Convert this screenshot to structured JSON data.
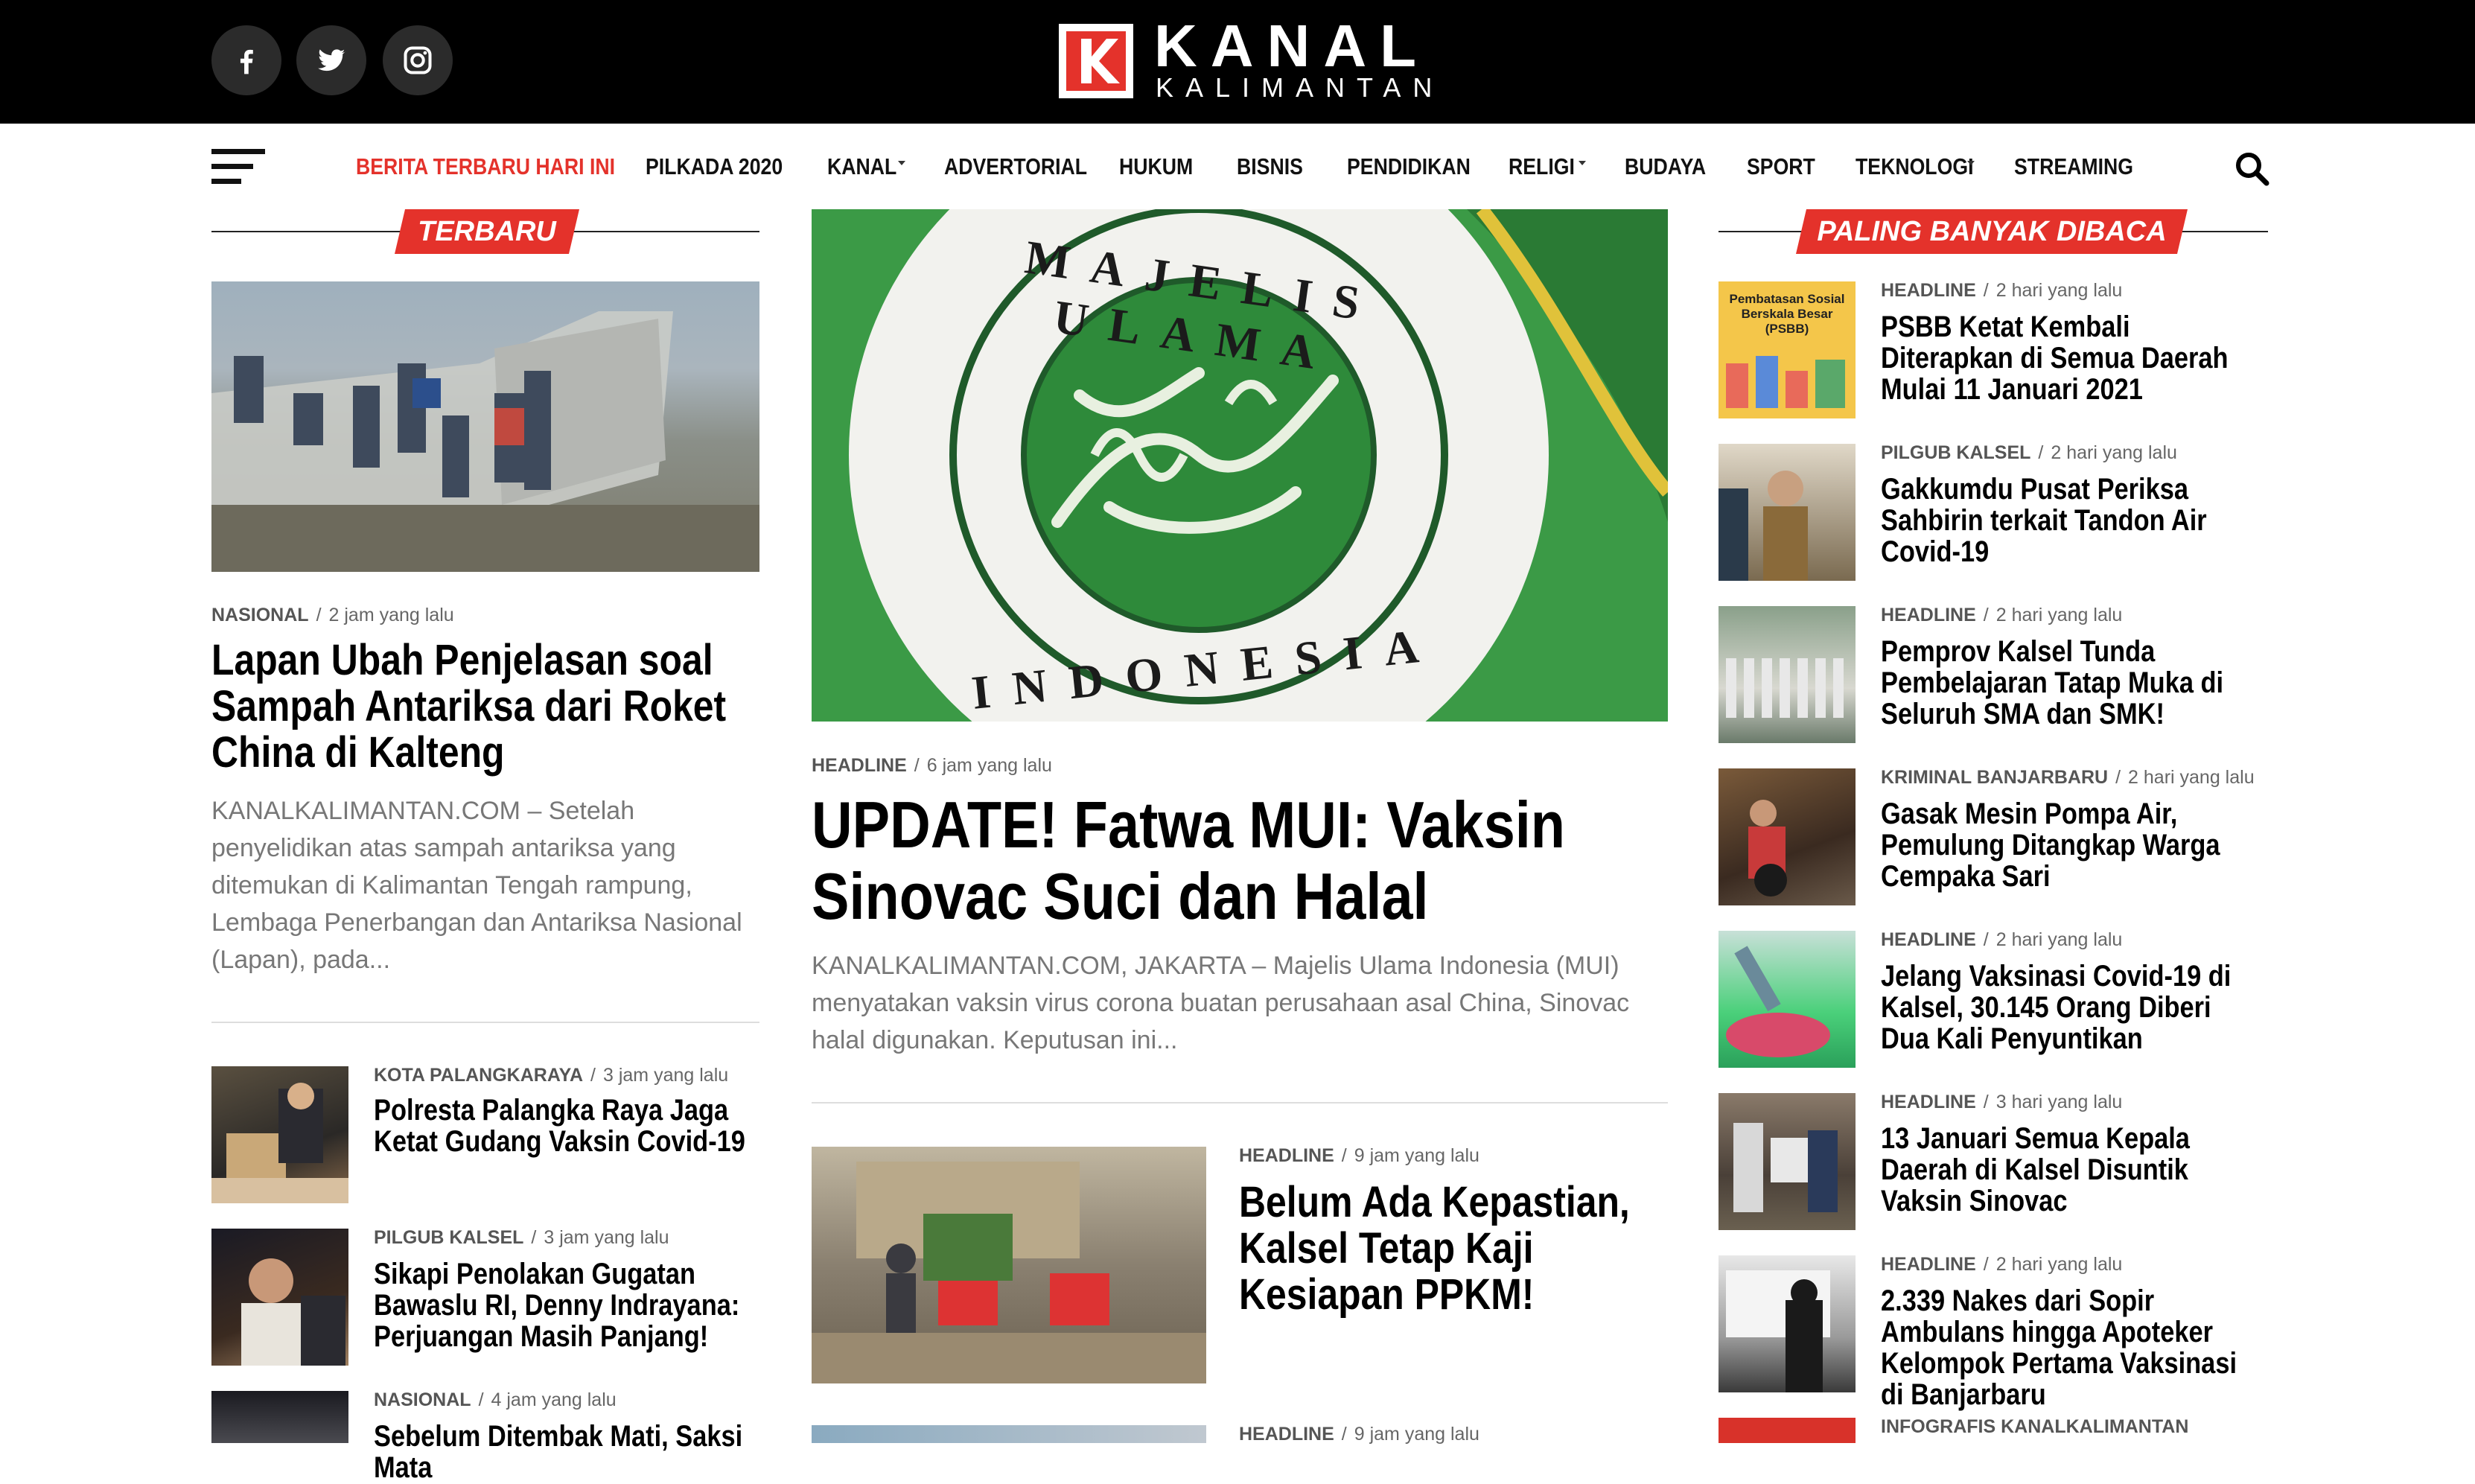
{
  "header": {
    "brand_title": "KANAL",
    "brand_subtitle": "KALIMANTAN",
    "social": [
      "facebook-icon",
      "twitter-icon",
      "instagram-icon"
    ]
  },
  "nav": {
    "items": [
      {
        "label": "BERITA TERBARU HARI INI",
        "active": true
      },
      {
        "label": "PILKADA 2020"
      },
      {
        "label": "KANAL",
        "dropdown": true
      },
      {
        "label": "ADVERTORIAL"
      },
      {
        "label": "HUKUM"
      },
      {
        "label": "BISNIS"
      },
      {
        "label": "PENDIDIKAN"
      },
      {
        "label": "RELIGI",
        "dropdown": true
      },
      {
        "label": "BUDAYA"
      },
      {
        "label": "SPORT"
      },
      {
        "label": "TEKNOLOGI",
        "dropdown": true
      },
      {
        "label": "STREAMING"
      }
    ]
  },
  "sections": {
    "left_label": "TERBARU",
    "right_label": "PALING BANYAK DIBACA"
  },
  "left": {
    "feature": {
      "category": "NASIONAL",
      "time": "2 jam yang lalu",
      "title": "Lapan Ubah Penjelasan soal Sampah Antariksa dari Roket China di Kalteng",
      "excerpt": "KANALKALIMANTAN.COM – Setelah penyelidikan atas sampah antariksa yang ditemukan di Kalimantan Tengah rampung, Lembaga Penerbangan dan Antariksa Nasional (Lapan), pada..."
    },
    "list": [
      {
        "category": "KOTA PALANGKARAYA",
        "time": "3 jam yang lalu",
        "title": "Polresta Palangka Raya Jaga Ketat Gudang Vaksin Covid-19"
      },
      {
        "category": "PILGUB KALSEL",
        "time": "3 jam yang lalu",
        "title": "Sikapi Penolakan Gugatan Bawaslu RI, Denny Indrayana: Perjuangan Masih Panjang!"
      },
      {
        "category": "NASIONAL",
        "time": "4 jam yang lalu",
        "title": "Sebelum Ditembak Mati, Saksi Mata"
      }
    ]
  },
  "center": {
    "hero": {
      "seal_top": "MAJELIS ULAMA",
      "seal_bottom": "INDONESIA",
      "category": "HEADLINE",
      "time": "6 jam yang lalu",
      "title": "UPDATE! Fatwa MUI: Vaksin Sinovac Suci dan Halal",
      "excerpt": "KANALKALIMANTAN.COM, JAKARTA – Majelis Ulama Indonesia (MUI) menyatakan vaksin virus corona buatan perusahaan asal China, Sinovac halal digunakan. Keputusan ini..."
    },
    "list": [
      {
        "category": "HEADLINE",
        "time": "9 jam yang lalu",
        "title": "Belum Ada Kepastian, Kalsel Tetap Kaji Kesiapan PPKM!"
      },
      {
        "category": "HEADLINE",
        "time": "9 jam yang lalu",
        "title": ""
      }
    ]
  },
  "right": {
    "list": [
      {
        "category": "HEADLINE",
        "time": "2 hari yang lalu",
        "title": "PSBB Ketat Kembali Diterapkan di Semua Daerah Mulai 11 Januari 2021",
        "thumb_text": "Pembatasan Sosial Berskala Besar (PSBB)"
      },
      {
        "category": "PILGUB KALSEL",
        "time": "2 hari yang lalu",
        "title": "Gakkumdu Pusat Periksa Sahbirin terkait Tandon Air Covid-19"
      },
      {
        "category": "HEADLINE",
        "time": "2 hari yang lalu",
        "title": "Pemprov Kalsel Tunda Pembelajaran Tatap Muka di Seluruh SMA dan SMK!"
      },
      {
        "category": "KRIMINAL BANJARBARU",
        "time": "2 hari yang lalu",
        "title": "Gasak Mesin Pompa Air, Pemulung Ditangkap Warga Cempaka Sari"
      },
      {
        "category": "HEADLINE",
        "time": "2 hari yang lalu",
        "title": "Jelang Vaksinasi Covid-19 di Kalsel, 30.145 Orang Diberi Dua Kali Penyuntikan"
      },
      {
        "category": "HEADLINE",
        "time": "3 hari yang lalu",
        "title": "13 Januari Semua Kepala Daerah di Kalsel Disuntik Vaksin Sinovac"
      },
      {
        "category": "HEADLINE",
        "time": "2 hari yang lalu",
        "title": "2.339 Nakes dari Sopir Ambulans hingga Apoteker Kelompok Pertama Vaksinasi di Banjarbaru"
      },
      {
        "category": "INFOGRAFIS KANALKALIMANTAN",
        "time": "",
        "title": ""
      }
    ]
  },
  "colors": {
    "accent": "#e4322b",
    "topbar": "#000000"
  }
}
